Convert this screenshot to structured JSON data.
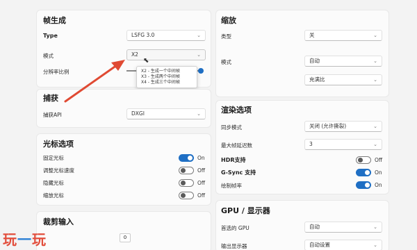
{
  "accent_color": "#1f6fc4",
  "annotation_color": "#e04a33",
  "frame_gen": {
    "title": "帧生成",
    "type_label": "Type",
    "type_value": "LSFG 3.0",
    "mode_label": "模式",
    "mode_value": "X2",
    "scale_label": "分辨率比例",
    "scale_fraction": 1.0,
    "mode_options": [
      "X2 - 生成一个中间帧",
      "X3 - 生成两个中间帧",
      "X4 - 生成三个中间帧"
    ]
  },
  "capture": {
    "title": "捕获",
    "api_label": "捕获API",
    "api_value": "DXGI"
  },
  "cursor": {
    "title": "光标选项",
    "items": [
      {
        "label": "固定光标",
        "state": "On",
        "on": true
      },
      {
        "label": "调整光标速度",
        "state": "Off",
        "on": false
      },
      {
        "label": "隐藏光标",
        "state": "Off",
        "on": false
      },
      {
        "label": "缩放光标",
        "state": "Off",
        "on": false
      }
    ]
  },
  "crop": {
    "title": "裁剪输入",
    "value": "0"
  },
  "scaling": {
    "title": "缩放",
    "type_label": "类型",
    "type_value": "关",
    "mode_label": "模式",
    "mode_value": "自动",
    "mode_value2": "充满比"
  },
  "render": {
    "title": "渲染选项",
    "sync_label": "同步模式",
    "sync_value": "关闭 (允许撕裂)",
    "frame_latency_label": "最大帧延迟数",
    "frame_latency_value": "3",
    "toggles": [
      {
        "label": "HDR支持",
        "state": "Off",
        "on": false
      },
      {
        "label": "G-Sync 支持",
        "state": "On",
        "on": true
      },
      {
        "label": "绘制帧率",
        "state": "On",
        "on": true
      }
    ]
  },
  "gpu": {
    "title": "GPU / 显示器",
    "gpu_label": "首选的 GPU",
    "gpu_value": "自动",
    "display_label": "输出显示器",
    "display_value": "自动设置"
  },
  "watermark": {
    "part1": "玩",
    "part2": "一",
    "part3": "玩"
  }
}
